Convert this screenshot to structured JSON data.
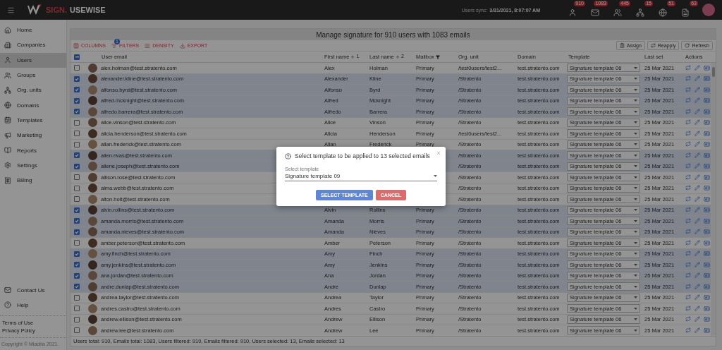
{
  "top_bar": {
    "logo": {
      "brand": "SIGN.",
      "name": "USEWISE"
    },
    "sync": {
      "label": "Users sync:",
      "value": "3/31/2021, 8:07:07 AM"
    },
    "notifications": [
      {
        "kind": "user",
        "count": "910"
      },
      {
        "kind": "mail",
        "count": "1083"
      },
      {
        "kind": "group",
        "count": "445"
      },
      {
        "kind": "tree",
        "count": "15"
      },
      {
        "kind": "globe",
        "count": "51"
      },
      {
        "kind": "template",
        "count": "63"
      }
    ]
  },
  "sidebar": {
    "items": [
      {
        "kind": "home",
        "label": "Home",
        "selected": false
      },
      {
        "kind": "companies",
        "label": "Companies",
        "selected": false
      },
      {
        "kind": "users",
        "label": "Users",
        "selected": true
      },
      {
        "kind": "groups",
        "label": "Groups",
        "selected": false
      },
      {
        "kind": "org",
        "label": "Org. units",
        "selected": false
      },
      {
        "kind": "domains",
        "label": "Domains",
        "selected": false
      },
      {
        "kind": "templates",
        "label": "Templates",
        "selected": false
      },
      {
        "kind": "marketing",
        "label": "Marketing",
        "selected": false
      },
      {
        "kind": "reports",
        "label": "Reports",
        "selected": false
      },
      {
        "kind": "settings",
        "label": "Settings",
        "selected": false
      },
      {
        "kind": "billing",
        "label": "Billing",
        "selected": false
      }
    ],
    "bottom_items": [
      {
        "kind": "contact",
        "label": "Contact Us"
      },
      {
        "kind": "help",
        "label": "Help"
      }
    ],
    "links": [
      "Terms of Use",
      "Privacy Policy"
    ],
    "copyright": "Copyright © Miadria 2021."
  },
  "title": "Manage signature for 910 users with 1083 emails",
  "toolbar": {
    "tools": [
      {
        "kind": "columns",
        "label": "COLUMNS"
      },
      {
        "kind": "filters",
        "label": "FILTERS",
        "badge": "1"
      },
      {
        "kind": "density",
        "label": "DENSITY"
      },
      {
        "kind": "export",
        "label": "EXPORT"
      }
    ],
    "buttons": [
      {
        "kind": "assign",
        "label": "Assign"
      },
      {
        "kind": "reapply",
        "label": "Reapply"
      },
      {
        "kind": "refresh",
        "label": "Refresh"
      }
    ]
  },
  "table": {
    "header_checkbox": {
      "partial": true
    },
    "columns": [
      {
        "label": "User email"
      },
      {
        "label": "First name",
        "sort": "1"
      },
      {
        "label": "Last name",
        "sort": "2"
      },
      {
        "label": "Mailbox",
        "filtered": true
      },
      {
        "label": "Org. unit"
      },
      {
        "label": "Domain"
      },
      {
        "label": "Template"
      },
      {
        "label": "Last set"
      },
      {
        "label": "Actions"
      }
    ],
    "rows": [
      {
        "checked": false,
        "email": "alex.holman@test.stratento.com",
        "first": "Alex",
        "last": "Holman",
        "mailbox": "Primary",
        "org_unit": "/test0users/test2...",
        "domain": "test.stratento.com",
        "template": "Signature template 06",
        "last_set": "25 Mar 2021"
      },
      {
        "checked": true,
        "email": "alexander.kline@test.stratento.com",
        "first": "Alexander",
        "last": "Kline",
        "mailbox": "Primary",
        "org_unit": "/Stratento",
        "domain": "test.stratento.com",
        "template": "Signature template 06",
        "last_set": "25 Mar 2021"
      },
      {
        "checked": true,
        "email": "alfonso.byrd@test.stratento.com",
        "first": "Alfonso",
        "last": "Byrd",
        "mailbox": "Primary",
        "org_unit": "/Stratento",
        "domain": "test.stratento.com",
        "template": "Signature template 06",
        "last_set": "25 Mar 2021"
      },
      {
        "checked": true,
        "email": "alfred.mcknight@test.stratento.com",
        "first": "Alfred",
        "last": "Mcknight",
        "mailbox": "Primary",
        "org_unit": "/Stratento",
        "domain": "test.stratento.com",
        "template": "Signature template 06",
        "last_set": "25 Mar 2021"
      },
      {
        "checked": true,
        "email": "alfredo.barrera@test.stratento.com",
        "first": "Alfredo",
        "last": "Barrera",
        "mailbox": "Primary",
        "org_unit": "/Stratento",
        "domain": "test.stratento.com",
        "template": "Signature template 06",
        "last_set": "25 Mar 2021"
      },
      {
        "checked": false,
        "email": "alice.vinson@test.stratento.com",
        "first": "Alice",
        "last": "Vinson",
        "mailbox": "Primary",
        "org_unit": "/Stratento",
        "domain": "test.stratento.com",
        "template": "Signature template 06",
        "last_set": "25 Mar 2021"
      },
      {
        "checked": false,
        "email": "alicia.henderson@test.stratento.com",
        "first": "Alicia",
        "last": "Henderson",
        "mailbox": "Primary",
        "org_unit": "/test0users/test2...",
        "domain": "test.stratento.com",
        "template": "Signature template 06",
        "last_set": "25 Mar 2021"
      },
      {
        "checked": false,
        "email": "allan.frederick@test.stratento.com",
        "first": "Allan",
        "last": "Frederick",
        "mailbox": "Primary",
        "org_unit": "/Stratento",
        "domain": "test.stratento.com",
        "template": "Signature template 06",
        "last_set": "25 Mar 2021"
      },
      {
        "checked": true,
        "email": "allen.rivas@test.stratento.com",
        "org_unit": "/Stratento",
        "domain": "test.stratento.com",
        "template": "Signature template 06",
        "last_set": "25 Mar 2021"
      },
      {
        "checked": true,
        "email": "allene.joseph@test.stratento.com",
        "org_unit": "/Stratento",
        "domain": "test.stratento.com",
        "template": "Signature template 06",
        "last_set": "25 Mar 2021"
      },
      {
        "checked": false,
        "email": "allison.rose@test.stratento.com",
        "org_unit": "/Stratento",
        "domain": "test.stratento.com",
        "template": "Signature template 06",
        "last_set": "25 Mar 2021"
      },
      {
        "checked": false,
        "email": "alma.webb@test.stratento.com",
        "org_unit": "/Stratento",
        "domain": "test.stratento.com",
        "template": "Signature template 06",
        "last_set": "25 Mar 2021"
      },
      {
        "checked": false,
        "email": "alton.holt@test.stratento.com",
        "org_unit": "/Stratento",
        "domain": "test.stratento.com",
        "template": "Signature template 06",
        "last_set": "25 Mar 2021"
      },
      {
        "checked": true,
        "email": "alvin.rollins@test.stratento.com",
        "first": "Alvin",
        "last": "Rollins",
        "mailbox": "Primary",
        "org_unit": "/Stratento",
        "domain": "test.stratento.com",
        "template": "Signature template 06",
        "last_set": "25 Mar 2021"
      },
      {
        "checked": true,
        "email": "amanda.morris@test.stratento.com",
        "first": "Amanda",
        "last": "Morris",
        "mailbox": "Primary",
        "org_unit": "/Stratento",
        "domain": "test.stratento.com",
        "template": "Signature template 06",
        "last_set": "25 Mar 2021"
      },
      {
        "checked": true,
        "email": "amanda.nieves@test.stratento.com",
        "first": "Amanda",
        "last": "Nieves",
        "mailbox": "Primary",
        "org_unit": "/Stratento",
        "domain": "test.stratento.com",
        "template": "Signature template 06",
        "last_set": "25 Mar 2021"
      },
      {
        "checked": false,
        "email": "amber.peterson@test.stratento.com",
        "first": "Amber",
        "last": "Peterson",
        "mailbox": "Primary",
        "org_unit": "/Stratento",
        "domain": "test.stratento.com",
        "template": "Signature template 06",
        "last_set": "25 Mar 2021"
      },
      {
        "checked": true,
        "email": "amy.finch@test.stratento.com",
        "first": "Amy",
        "last": "Finch",
        "mailbox": "Primary",
        "org_unit": "/Stratento",
        "domain": "test.stratento.com",
        "template": "Signature template 06",
        "last_set": "25 Mar 2021"
      },
      {
        "checked": true,
        "email": "amy.jenkins@test.stratento.com",
        "first": "Amy",
        "last": "Jenkins",
        "mailbox": "Primary",
        "org_unit": "/Stratento",
        "domain": "test.stratento.com",
        "template": "Signature template 06",
        "last_set": "25 Mar 2021"
      },
      {
        "checked": true,
        "email": "ana.jordan@test.stratento.com",
        "first": "Ana",
        "last": "Jordan",
        "mailbox": "Primary",
        "org_unit": "/Stratento",
        "domain": "test.stratento.com",
        "template": "Signature template 06",
        "last_set": "25 Mar 2021"
      },
      {
        "checked": true,
        "email": "andre.dunlap@test.stratento.com",
        "first": "Andre",
        "last": "Dunlap",
        "mailbox": "Primary",
        "org_unit": "/Stratento",
        "domain": "test.stratento.com",
        "template": "Signature template 06",
        "last_set": "25 Mar 2021"
      },
      {
        "checked": false,
        "email": "andrea.taylor@test.stratento.com",
        "first": "Andrea",
        "last": "Taylor",
        "mailbox": "Primary",
        "org_unit": "/Stratento",
        "domain": "test.stratento.com",
        "template": "Signature template 06",
        "last_set": "25 Mar 2021"
      },
      {
        "checked": false,
        "email": "andres.castro@test.stratento.com",
        "first": "Andres",
        "last": "Castro",
        "mailbox": "Primary",
        "org_unit": "/Stratento",
        "domain": "test.stratento.com",
        "template": "Signature template 06",
        "last_set": "25 Mar 2021"
      },
      {
        "checked": false,
        "email": "andrew.ellison@test.stratento.com",
        "first": "Andrew",
        "last": "Ellison",
        "mailbox": "Primary",
        "org_unit": "/Stratento",
        "domain": "test.stratento.com",
        "template": "Signature template 06",
        "last_set": "25 Mar 2021"
      },
      {
        "checked": false,
        "email": "andrew.lee@test.stratento.com",
        "first": "Andrew",
        "last": "Lee",
        "mailbox": "Primary",
        "org_unit": "/Stratento",
        "domain": "test.stratento.com",
        "template": "Signature template 06",
        "last_set": "25 Mar 2021"
      }
    ]
  },
  "footer": "Users total: 910, Emails total: 1083, Users filtered: 910, Emails filtered: 910, Users selected: 13, Emails selected: 13",
  "dialog": {
    "title": "Select template to be applied to 13 selected emails",
    "field": {
      "label": "Select template",
      "value": "Signature template 09"
    },
    "buttons": [
      {
        "kind": "primary",
        "label": "SELECT TEMPLATE"
      },
      {
        "kind": "cancel",
        "label": "CANCEL"
      }
    ]
  }
}
